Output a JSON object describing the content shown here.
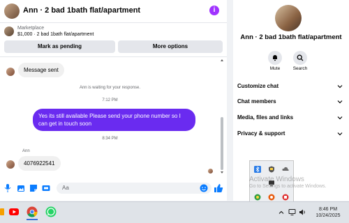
{
  "header": {
    "title": "Ann · 2 bad 1bath flat/apartment",
    "info_icon": "i"
  },
  "marketplace": {
    "label": "Marketplace",
    "listing": "$1,000 · 2 bad 1bath flat/apartment",
    "pending_btn": "Mark as pending",
    "more_btn": "More options"
  },
  "messages": {
    "msg1": "Message sent",
    "waiting": "Ann is waiting for your response.",
    "time1": "7:12 PM",
    "out_msg": "Yes its still available Please send your phone number so I can get in touch soon",
    "time2": "8:34 PM",
    "sender": "Ann",
    "msg2": "4076922541"
  },
  "composer": {
    "placeholder": "Aa"
  },
  "side": {
    "title": "Ann · 2 bad 1bath flat/apartment",
    "mute_label": "Mute",
    "search_label": "Search",
    "rows": [
      "Customize chat",
      "Chat members",
      "Media, files and links",
      "Privacy & support"
    ]
  },
  "taskbar": {
    "time": "8:46 PM",
    "date": "10/24/2025"
  },
  "watermark": {
    "line1": "Activate Windows",
    "line2": "Go to Settings to activate Windows."
  },
  "colors": {
    "accent": "#6a2bf0",
    "info": "#a033ff",
    "messenger_blue": "#0a7cff"
  }
}
